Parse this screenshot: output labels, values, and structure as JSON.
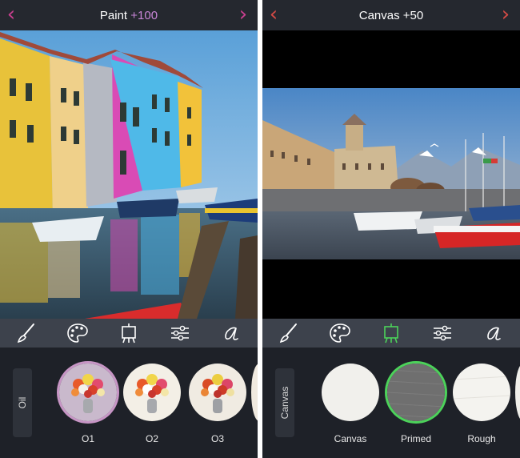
{
  "left_screen": {
    "title": "Paint",
    "title_value": "+100",
    "title_value_color": "#c986d8",
    "arrow_color": "#c93f8f",
    "category_label": "Oil",
    "presets": [
      {
        "label": "O1",
        "selected": true
      },
      {
        "label": "O2",
        "selected": false
      },
      {
        "label": "O3",
        "selected": false
      }
    ],
    "selection_color": "#c795c5"
  },
  "right_screen": {
    "title": "Canvas",
    "title_value": "+50",
    "arrow_color": "#d24a45",
    "category_label": "Canvas",
    "presets": [
      {
        "label": "Canvas",
        "selected": false
      },
      {
        "label": "Primed",
        "selected": true
      },
      {
        "label": "Rough",
        "selected": false
      }
    ],
    "selection_color": "#4cd25a"
  },
  "toolbar_icons": [
    "brush-icon",
    "palette-icon",
    "easel-icon",
    "sliders-icon",
    "script-a-icon"
  ]
}
